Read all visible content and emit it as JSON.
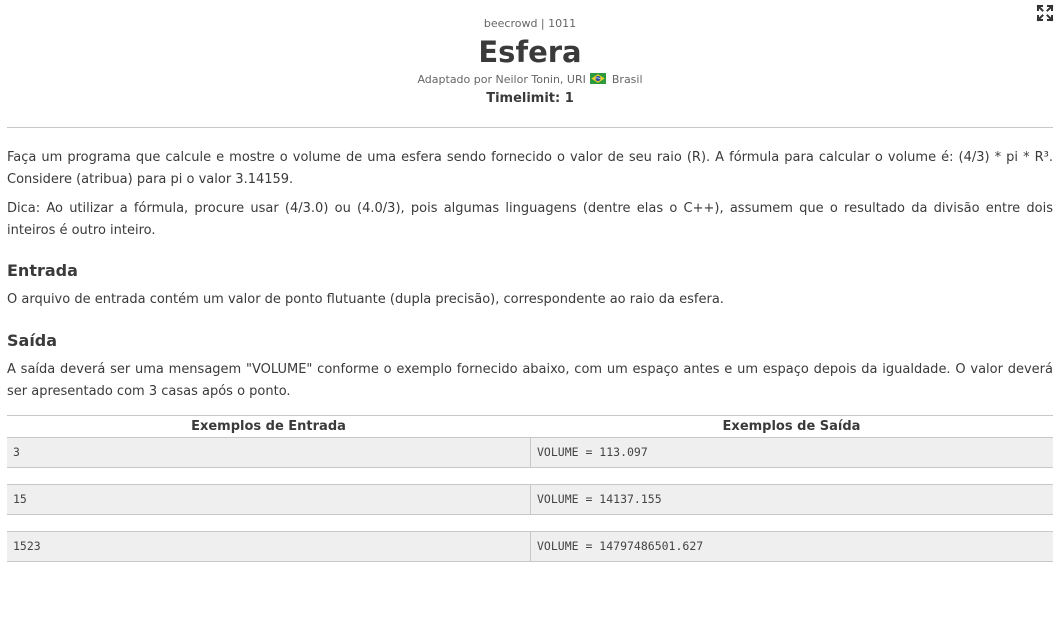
{
  "header": {
    "crumb": "beecrowd | 1011",
    "title": "Esfera",
    "author_prefix": "Adaptado por Neilor Tonin, URI",
    "country": "Brasil",
    "timelimit": "Timelimit: 1"
  },
  "toolbar": {
    "expand_icon": "expand-icon"
  },
  "description": {
    "paragraph1": "Faça um programa que calcule e mostre o volume de uma esfera sendo fornecido o valor de seu raio (R). A fórmula para calcular o volume é: (4/3) * pi * R³. Considere (atribua) para pi o valor 3.14159.",
    "paragraph2": "Dica: Ao utilizar a fórmula, procure usar (4/3.0) ou (4.0/3), pois algumas linguagens (dentre elas o C++), assumem que o resultado da divisão entre dois inteiros é outro inteiro."
  },
  "input_section": {
    "title": "Entrada",
    "text": "O arquivo de entrada contém um valor de ponto flutuante (dupla precisão), correspondente ao raio da esfera."
  },
  "output_section": {
    "title": "Saída",
    "text": "A saída deverá ser uma mensagem \"VOLUME\" conforme o exemplo fornecido abaixo, com um espaço antes e um espaço depois da igualdade. O valor deverá ser apresentado com 3 casas após o ponto."
  },
  "examples": {
    "input_header": "Exemplos de Entrada",
    "output_header": "Exemplos de Saída",
    "rows": [
      {
        "input": "3",
        "output": "VOLUME = 113.097"
      },
      {
        "input": "15",
        "output": "VOLUME = 14137.155"
      },
      {
        "input": "1523",
        "output": "VOLUME = 14797486501.627"
      }
    ]
  },
  "colors": {
    "text": "#3a3a3a",
    "rule": "#c8c8c8",
    "example_bg": "#efefef",
    "flag_green": "#2e9a3e",
    "flag_yellow": "#f2d12c",
    "flag_blue": "#2a4f9c"
  }
}
